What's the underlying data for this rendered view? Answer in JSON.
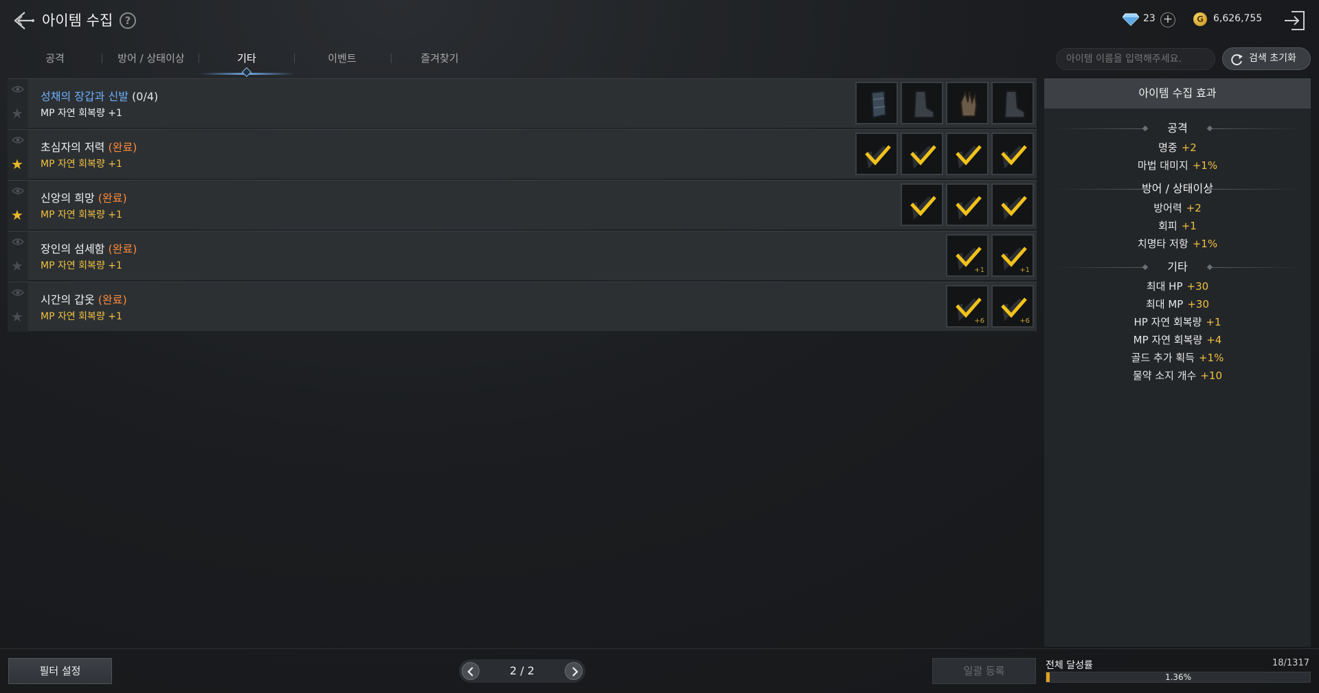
{
  "header": {
    "title": "아이템 수집",
    "help": "?",
    "gems": "23",
    "gem_plus": "+",
    "gold_symbol": "G",
    "gold": "6,626,755"
  },
  "tabs": [
    {
      "label": "공격",
      "active": false
    },
    {
      "label": "방어 / 상태이상",
      "active": false
    },
    {
      "label": "기타",
      "active": true
    },
    {
      "label": "이벤트",
      "active": false
    },
    {
      "label": "즐겨찾기",
      "active": false
    }
  ],
  "search": {
    "placeholder": "아이템 이름을 입력해주세요.",
    "reset_label": "검색 초기화"
  },
  "collections": [
    {
      "name": "성채의 장갑과 신발",
      "status": "(0/4)",
      "effect": "MP 자연 회복량 +1",
      "complete": false,
      "favorite": false,
      "slots": [
        {
          "icon": "bracer-icon",
          "done": false,
          "enh": ""
        },
        {
          "icon": "boot-icon",
          "done": false,
          "enh": ""
        },
        {
          "icon": "glove-icon",
          "done": false,
          "enh": ""
        },
        {
          "icon": "boot-icon",
          "done": false,
          "enh": ""
        }
      ]
    },
    {
      "name": "초심자의 저력",
      "status": "(완료)",
      "effect": "MP 자연 회복량 +1",
      "complete": true,
      "favorite": true,
      "slots": [
        {
          "icon": "check-icon",
          "done": true,
          "enh": ""
        },
        {
          "icon": "check-icon",
          "done": true,
          "enh": ""
        },
        {
          "icon": "check-icon",
          "done": true,
          "enh": ""
        },
        {
          "icon": "check-icon",
          "done": true,
          "enh": ""
        }
      ]
    },
    {
      "name": "신앙의 희망",
      "status": "(완료)",
      "effect": "MP 자연 회복량 +1",
      "complete": true,
      "favorite": true,
      "slots": [
        {
          "icon": "check-icon",
          "done": true,
          "enh": ""
        },
        {
          "icon": "check-icon",
          "done": true,
          "enh": ""
        },
        {
          "icon": "check-icon",
          "done": true,
          "enh": ""
        }
      ]
    },
    {
      "name": "장인의 섬세함",
      "status": "(완료)",
      "effect": "MP 자연 회복량 +1",
      "complete": true,
      "favorite": false,
      "slots": [
        {
          "icon": "check-icon",
          "done": true,
          "enh": "+1"
        },
        {
          "icon": "check-icon",
          "done": true,
          "enh": "+1"
        }
      ]
    },
    {
      "name": "시간의 갑옷",
      "status": "(완료)",
      "effect": "MP 자연 회복량 +1",
      "complete": true,
      "favorite": false,
      "slots": [
        {
          "icon": "check-icon",
          "done": true,
          "enh": "+6"
        },
        {
          "icon": "check-icon",
          "done": true,
          "enh": "+6"
        }
      ]
    }
  ],
  "panel": {
    "title": "아이템 수집 효과",
    "sections": [
      {
        "title": "공격",
        "stats": [
          {
            "label": "명중",
            "value": "+2"
          },
          {
            "label": "마법 대미지",
            "value": "+1%"
          }
        ]
      },
      {
        "title": "방어 / 상태이상",
        "stats": [
          {
            "label": "방어력",
            "value": "+2"
          },
          {
            "label": "회피",
            "value": "+1"
          },
          {
            "label": "치명타 저항",
            "value": "+1%"
          }
        ]
      },
      {
        "title": "기타",
        "stats": [
          {
            "label": "최대 HP",
            "value": "+30"
          },
          {
            "label": "최대 MP",
            "value": "+30"
          },
          {
            "label": "HP 자연 회복량",
            "value": "+1"
          },
          {
            "label": "MP 자연 회복량",
            "value": "+4"
          },
          {
            "label": "골드 추가 획득",
            "value": "+1%"
          },
          {
            "label": "물약 소지 개수",
            "value": "+10"
          }
        ]
      }
    ]
  },
  "bottom": {
    "filter_label": "필터 설정",
    "page": "2 / 2",
    "bulk_label": "일괄 등록",
    "progress_label": "전체 달성률",
    "progress_count": "18/1317",
    "progress_pct_text": "1.36%",
    "progress_fraction": 0.0136
  },
  "colors": {
    "accent_gold": "#f0c040",
    "complete_orange": "#ff8a3a",
    "link_blue": "#6fb0ff",
    "tab_active_underline": "#6da6e0"
  }
}
